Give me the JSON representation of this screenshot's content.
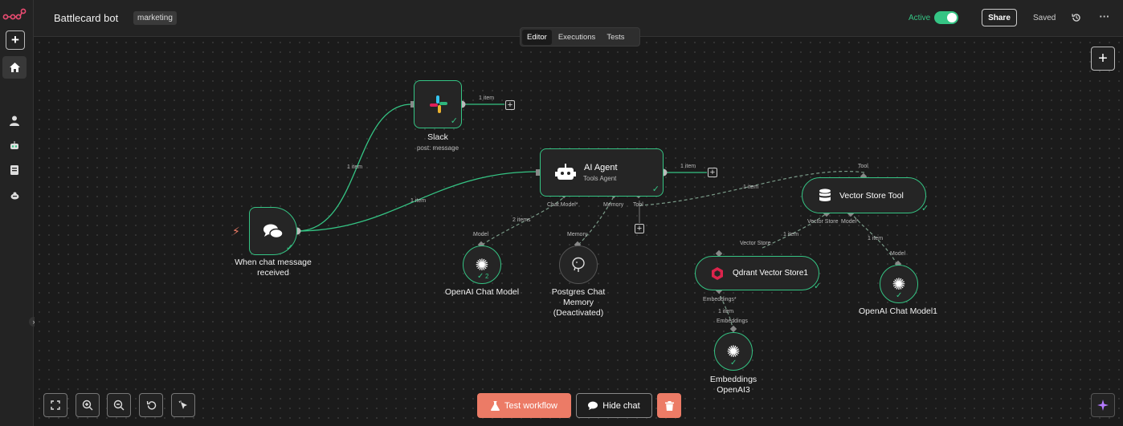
{
  "header": {
    "workflow_name": "Battlecard bot",
    "tag": "marketing",
    "active_label": "Active",
    "active": true,
    "share_label": "Share",
    "saved_label": "Saved"
  },
  "tabs": [
    {
      "label": "Editor",
      "selected": true
    },
    {
      "label": "Executions",
      "selected": false
    },
    {
      "label": "Tests",
      "selected": false
    }
  ],
  "sidebar": {
    "items": [
      "plus-icon",
      "home-icon",
      "user-icon",
      "robot-icon",
      "book-icon",
      "bug-icon"
    ]
  },
  "nodes": {
    "slack": {
      "title": "Slack",
      "subtitle": "post: message",
      "output": "1 item"
    },
    "trigger": {
      "title_line1": "When chat message",
      "title_line2": "received"
    },
    "agent": {
      "title": "AI Agent",
      "subtitle": "Tools Agent",
      "output": "1 item",
      "ports": {
        "chat_model": "Chat Model*",
        "memory": "Memory",
        "tool": "Tool"
      }
    },
    "openai_model": {
      "title": "OpenAI Chat Model",
      "port": "Model",
      "count": "2"
    },
    "postgres": {
      "line1": "Postgres Chat",
      "line2": "Memory",
      "line3": "(Deactivated)",
      "port": "Memory"
    },
    "vector_tool": {
      "title": "Vector Store Tool",
      "port_top": "Tool",
      "ports": {
        "vector_store": "Vector Store",
        "model": "Model*"
      }
    },
    "qdrant": {
      "title": "Qdrant Vector Store1",
      "port_top": "Vector Store",
      "port_bottom": "Embeddings*"
    },
    "openai_model1": {
      "title": "OpenAI Chat Model1",
      "port": "Model"
    },
    "embeddings": {
      "line1": "Embeddings",
      "line2": "OpenAI3",
      "port": "Embeddings"
    }
  },
  "edges": {
    "trigger_slack": "1 item",
    "trigger_agent": "1 item",
    "model_agent": "2 items",
    "vectortool_agent": "1 item",
    "qdrant_vectortool": "1 item",
    "model1_vectortool": "1 item",
    "emb_qdrant": "1 item"
  },
  "footer": {
    "test_label": "Test workflow",
    "hide_chat_label": "Hide chat"
  },
  "colors": {
    "accent": "#35c484",
    "primary": "#ec7b66",
    "logo": "#ea4b71"
  }
}
